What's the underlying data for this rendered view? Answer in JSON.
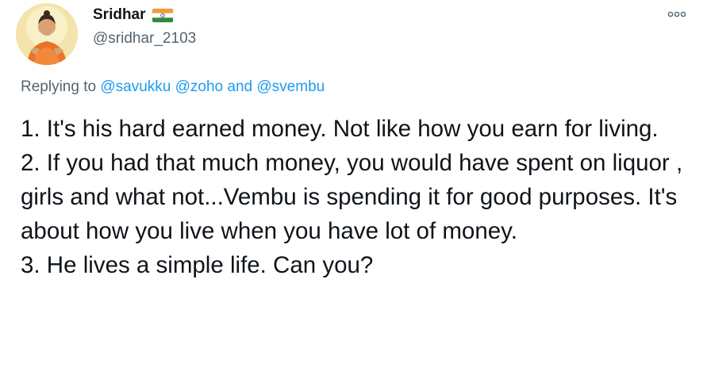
{
  "author": {
    "display_name": "Sridhar",
    "handle": "@sridhar_2103",
    "flag_icon": "india-flag-icon",
    "avatar_icon": "avatar-image"
  },
  "menu": {
    "more_icon": "more-options-icon"
  },
  "reply": {
    "prefix": "Replying to",
    "mention_1": "@savukku",
    "mention_2": "@zoho",
    "connector": "and",
    "mention_3": "@svembu"
  },
  "tweet": {
    "lines": [
      "1. It's his hard earned money. Not like how you earn for living.",
      "2. If you had that much money, you would have spent on liquor , girls and what not...Vembu is spending it for good purposes. It's about how you live when you have lot of money.",
      "3. He lives a simple life. Can you?"
    ]
  },
  "colors": {
    "text_primary": "#0f1419",
    "text_secondary": "#536471",
    "link": "#1d9bf0",
    "background": "#ffffff"
  }
}
